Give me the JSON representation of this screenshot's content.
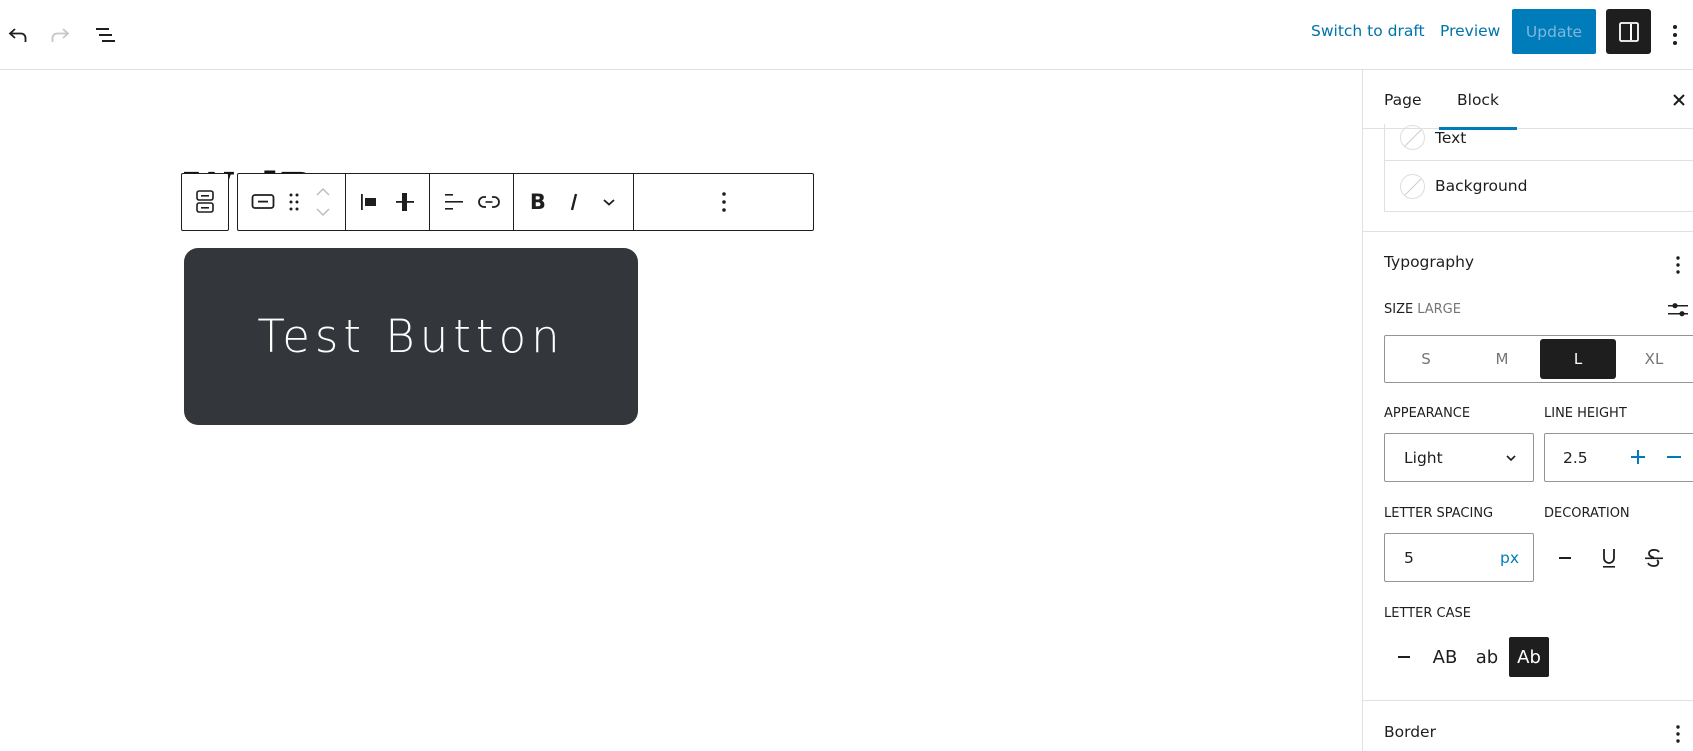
{
  "header": {
    "undo_label": "Undo",
    "redo_label": "Redo",
    "list_view_label": "Document overview",
    "switch_to_draft": "Switch to draft",
    "preview": "Preview",
    "update": "Update",
    "settings_label": "Settings",
    "options_label": "Options"
  },
  "canvas": {
    "page_title_fragment": "W    dP",
    "button_text": "Test Button",
    "button_color": "#33373b"
  },
  "toolbar": {
    "parent_label": "Select parent block: Buttons",
    "block_type_label": "Button",
    "drag_label": "Drag",
    "move_up_label": "Move up",
    "move_down_label": "Move down",
    "justify_left_label": "Justify items left",
    "vertical_align_label": "Change vertical alignment",
    "align_text_label": "Align text",
    "link_label": "Link",
    "bold_label": "Bold",
    "italic_label": "Italic",
    "more_label": "More",
    "options_label": "Options"
  },
  "sidebar": {
    "tabs": [
      {
        "label": "Page",
        "active": false
      },
      {
        "label": "Block",
        "active": true
      }
    ],
    "close_label": "Close settings",
    "color": {
      "items": [
        {
          "label": "Text"
        },
        {
          "label": "Background"
        }
      ]
    },
    "typography": {
      "title": "Typography",
      "size_label": "SIZE",
      "size_value": "LARGE",
      "size_options": [
        {
          "label": "S",
          "active": false
        },
        {
          "label": "M",
          "active": false
        },
        {
          "label": "L",
          "active": true
        },
        {
          "label": "XL",
          "active": false
        }
      ],
      "appearance_label": "APPEARANCE",
      "appearance_value": "Light",
      "line_height_label": "LINE HEIGHT",
      "line_height_value": "2.5",
      "letter_spacing_label": "LETTER SPACING",
      "letter_spacing_value": "5",
      "letter_spacing_unit": "px",
      "decoration_label": "DECORATION",
      "decoration_options": [
        {
          "label": "None",
          "icon": "minus-icon"
        },
        {
          "label": "Underline",
          "icon": "underline-icon"
        },
        {
          "label": "Strikethrough",
          "icon": "strikethrough-icon"
        }
      ],
      "letter_case_label": "LETTER CASE",
      "letter_case_options": [
        {
          "label": "–",
          "name": "none",
          "active": false
        },
        {
          "label": "AB",
          "name": "uppercase",
          "active": false
        },
        {
          "label": "ab",
          "name": "lowercase",
          "active": false
        },
        {
          "label": "Ab",
          "name": "capitalize",
          "active": true
        }
      ]
    },
    "border": {
      "title": "Border"
    }
  },
  "colors": {
    "accent": "#007cba",
    "dark": "#1e1e1e",
    "border": "#e0e0e0"
  }
}
